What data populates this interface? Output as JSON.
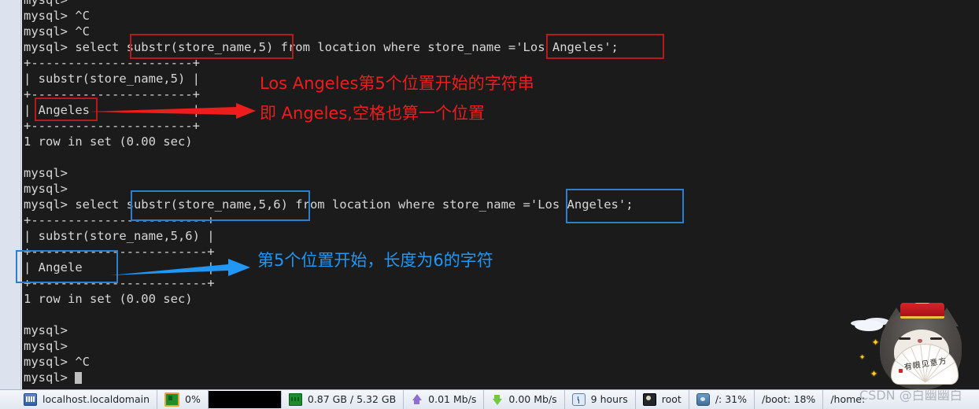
{
  "terminal": {
    "lines": [
      "mysql>",
      "mysql> ^C",
      "mysql> ^C",
      "mysql> select substr(store_name,5) from location where store_name ='Los Angeles';",
      "+----------------------+",
      "| substr(store_name,5) |",
      "+----------------------+",
      "| Angeles              |",
      "+----------------------+",
      "1 row in set (0.00 sec)",
      "",
      "mysql>",
      "mysql>",
      "mysql> select substr(store_name,5,6) from location where store_name ='Los Angeles';",
      "+------------------------+",
      "| substr(store_name,5,6) |",
      "+------------------------+",
      "| Angele                 |",
      "+------------------------+",
      "1 row in set (0.00 sec)",
      "",
      "mysql>",
      "mysql>",
      "mysql> ^C",
      "mysql>"
    ],
    "prompt": "mysql>",
    "cursor_line_text": "mysql> "
  },
  "annotations": {
    "red": {
      "color": "#ee1d1d",
      "line1": "Los Angeles第5个位置开始的字符串",
      "line2": "即 Angeles,空格也算一个位置",
      "boxes": [
        {
          "name": "substr-expression-box-1",
          "label": "substr(store_name,5)"
        },
        {
          "name": "where-value-box-1",
          "label": "'Los Angeles';"
        },
        {
          "name": "result-value-box-1",
          "label": "Angeles"
        }
      ]
    },
    "blue": {
      "color": "#2196f3",
      "line1": "第5个位置开始，长度为6的字符",
      "boxes": [
        {
          "name": "substr-expression-box-2",
          "label": "substr(store_name,5,6)"
        },
        {
          "name": "where-value-box-2",
          "label": "'Los Angeles';"
        },
        {
          "name": "result-value-box-2",
          "label": "Angele"
        }
      ]
    }
  },
  "sticker": {
    "fan_text": "有眼见意方",
    "watermark": "CSDN @白幽幽白"
  },
  "statusbar": {
    "items": [
      {
        "icon": "host-icon",
        "label": "localhost.localdomain"
      },
      {
        "icon": "cpu-icon",
        "label": "0%"
      },
      {
        "icon": "ram-icon",
        "label": "0.87 GB / 5.32 GB"
      },
      {
        "icon": "upload-icon",
        "label": "0.01 Mb/s"
      },
      {
        "icon": "download-icon",
        "label": "0.00 Mb/s"
      },
      {
        "icon": "clock-icon",
        "label": "9 hours"
      },
      {
        "icon": "user-icon",
        "label": "root"
      }
    ],
    "disks": {
      "icon": "disk-icon",
      "entries": [
        "/: 31%",
        "/boot: 18%",
        "/home:"
      ]
    }
  },
  "colors": {
    "terminal_bg": "#1b1b1b",
    "terminal_fg": "#d6d6d6",
    "red_accent": "#ee1d1d",
    "red_box": "#b51b1b",
    "blue_accent": "#2196f3",
    "blue_box": "#2b7fce",
    "statusbar_bg": "#eef2f8"
  }
}
